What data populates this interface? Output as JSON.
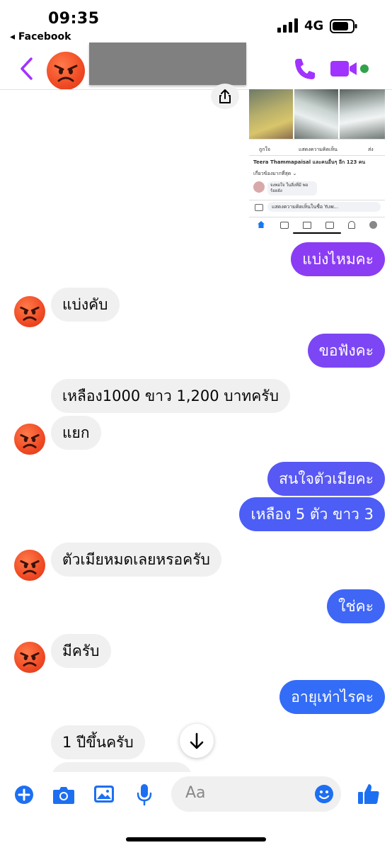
{
  "status_bar": {
    "time": "09:35",
    "back_app": "◂ Facebook",
    "network": "4G"
  },
  "header": {
    "contact_name": ""
  },
  "shared_screenshot": {
    "like": "ถูกใจ",
    "comment": "แสดงความคิดเห็น",
    "share": "ส่ง",
    "reactors": "Teera Thammapaisal และคนอื่นๆ อีก 123 คน",
    "relevant": "เกี่ยวข้องมากที่สุด ⌄",
    "comment_text": "จงพอใจ ในสิ่งที่มี พอร้อยยัง",
    "comment_input": "แสดงความคิดเห็นในชื่อ Yuw..."
  },
  "messages": [
    {
      "side": "out",
      "text": "แบ่งไหมคะ"
    },
    {
      "side": "in",
      "text": "แบ่งคับ"
    },
    {
      "side": "out",
      "text": "ขอฟังคะ"
    },
    {
      "side": "in",
      "text": "เหลือง1000 ขาว 1,200 บาทครับ"
    },
    {
      "side": "in",
      "text": "แยก"
    },
    {
      "side": "out",
      "text": "สนใจตัวเมียคะ"
    },
    {
      "side": "out",
      "text": "เหลือง 5 ตัว ขาว 3"
    },
    {
      "side": "in",
      "text": "ตัวเมียหมดเลยหรอครับ"
    },
    {
      "side": "out",
      "text": "ใช่คะ"
    },
    {
      "side": "in",
      "text": "มีครับ"
    },
    {
      "side": "out",
      "text": "อายุเท่าไรคะ"
    },
    {
      "side": "in",
      "text": "1 ปีขึ้นครับ"
    }
  ],
  "composer": {
    "placeholder": "Aa"
  },
  "colors": {
    "accent": "#a033ff",
    "bubble_top": "#8c3bf5",
    "bubble_bottom": "#2f6cf6",
    "incoming": "#f0f0f0"
  }
}
